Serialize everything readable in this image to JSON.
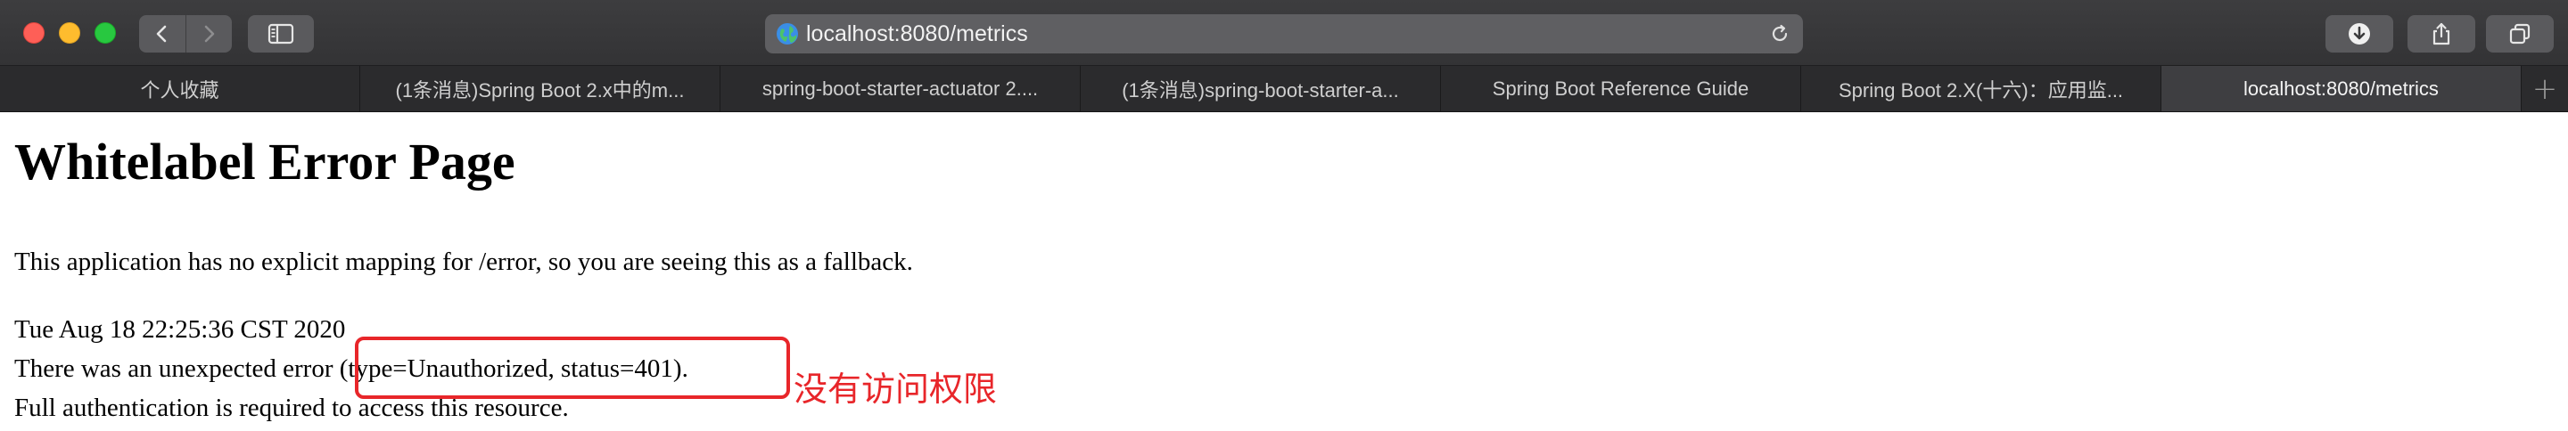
{
  "browser": {
    "address_url": "localhost:8080/metrics",
    "tabs": [
      {
        "label": "个人收藏",
        "active": false
      },
      {
        "label": "(1条消息)Spring Boot 2.x中的m...",
        "active": false
      },
      {
        "label": "spring-boot-starter-actuator 2....",
        "active": false
      },
      {
        "label": "(1条消息)spring-boot-starter-a...",
        "active": false
      },
      {
        "label": "Spring Boot Reference Guide",
        "active": false
      },
      {
        "label": "Spring Boot 2.X(十六)：应用监...",
        "active": false
      },
      {
        "label": "localhost:8080/metrics",
        "active": true
      }
    ],
    "new_tab_label": "+",
    "icons": {
      "back": "chevron-left-icon",
      "forward": "chevron-right-icon",
      "sidebar": "sidebar-icon",
      "site": "globe-icon",
      "reload": "reload-icon",
      "download": "download-icon",
      "share": "share-icon",
      "tabs_overview": "tabs-overview-icon"
    },
    "colors": {
      "close": "#fe5f57",
      "minimize": "#febc2e",
      "zoom": "#28c840"
    }
  },
  "page": {
    "heading": "Whitelabel Error Page",
    "description": "This application has no explicit mapping for /error, so you are seeing this as a fallback.",
    "timestamp": "Tue Aug 18 22:25:36 CST 2020",
    "error_line": "There was an unexpected error (type=Unauthorized, status=401).",
    "auth_line": "Full authentication is required to access this resource."
  },
  "annotation": {
    "text": "没有访问权限",
    "color": "#e8262a"
  }
}
